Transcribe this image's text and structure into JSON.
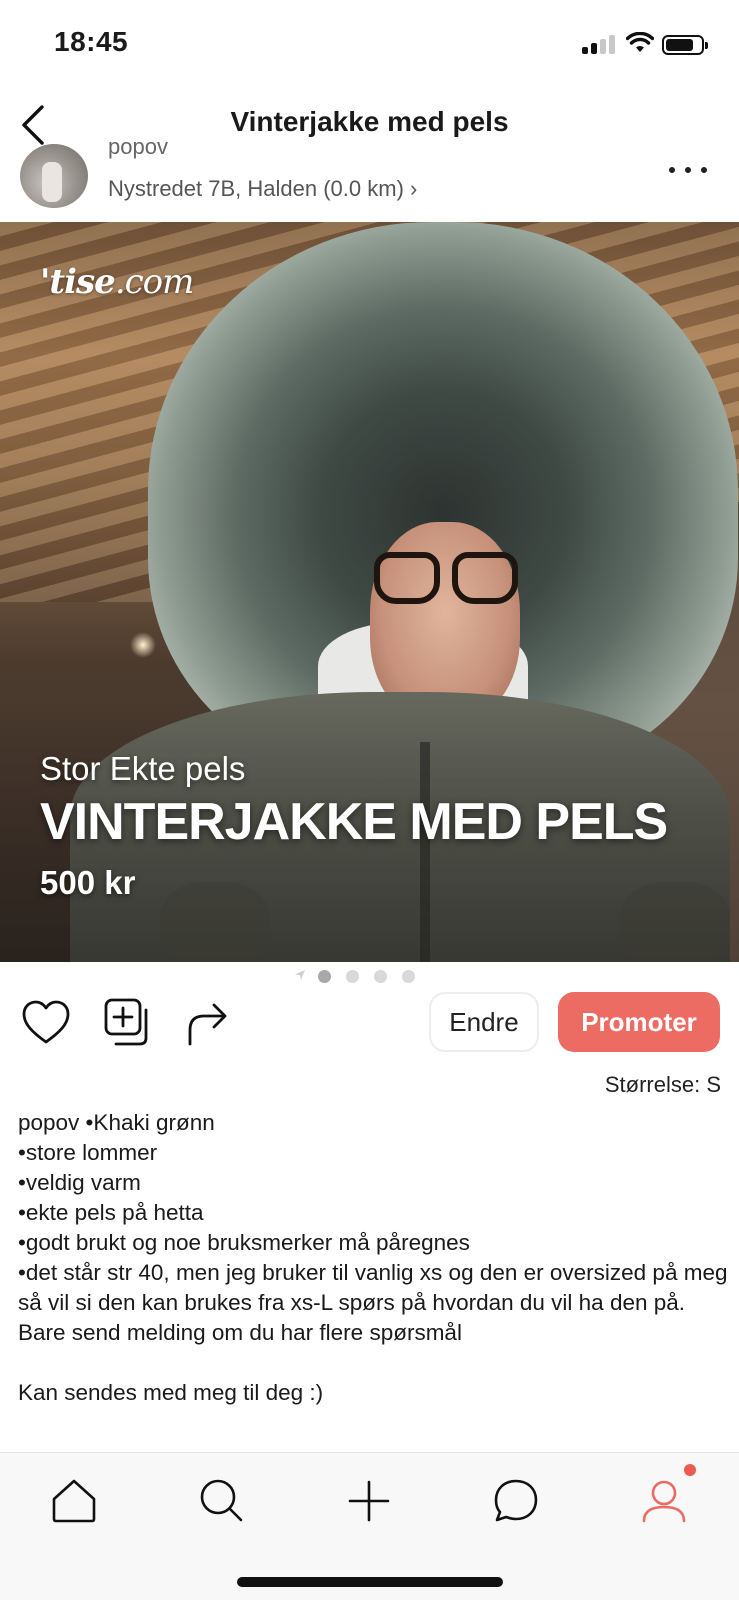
{
  "status_bar": {
    "time": "18:45",
    "signal_bars_active": 2,
    "battery_level": 0.7
  },
  "header": {
    "title": "Vinterjakke med pels",
    "back_icon": "chevron-left-icon"
  },
  "seller": {
    "name": "popov",
    "location": "Nystredet 7B, Halden (0.0 km) ›",
    "more_icon": "more-horizontal-icon"
  },
  "hero": {
    "watermark_prefix": "'tise",
    "watermark_suffix": ".com",
    "subtitle": "Stor Ekte pels",
    "title": "VINTERJAKKE MED PELS",
    "price": "500 kr"
  },
  "pager": {
    "total_dots": 4,
    "active_index": 0
  },
  "actions": {
    "like_icon": "heart-icon",
    "save_icon": "add-to-collection-icon",
    "share_icon": "share-arrow-icon",
    "edit_label": "Endre",
    "promote_label": "Promoter",
    "promote_color": "#ec6b62"
  },
  "size": {
    "label": "Størrelse: S"
  },
  "description": "popov •Khaki grønn\n•store lommer\n•veldig varm\n•ekte pels på hetta\n•godt brukt og noe bruksmerker må påregnes\n•det står str 40, men jeg bruker til vanlig xs og den er oversized på meg så vil si den kan brukes fra xs-L spørs på hvordan du vil ha den på.\nBare send melding om du har flere spørsmål\n\nKan sendes med meg til deg :)",
  "tab_bar": {
    "tabs": [
      {
        "icon": "home-icon"
      },
      {
        "icon": "search-icon"
      },
      {
        "icon": "plus-icon"
      },
      {
        "icon": "chat-icon"
      },
      {
        "icon": "profile-icon",
        "active": true,
        "badge": true
      }
    ],
    "active_color": "#ec6b62"
  }
}
